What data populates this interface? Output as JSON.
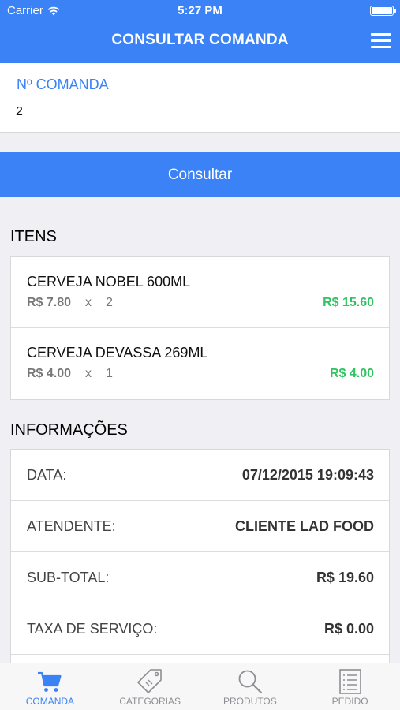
{
  "status_bar": {
    "carrier": "Carrier",
    "time": "5:27 PM"
  },
  "header": {
    "title": "CONSULTAR COMANDA",
    "menu_icon": "hamburger-menu-icon"
  },
  "form": {
    "label": "Nº COMANDA",
    "value": "2",
    "button_label": "Consultar"
  },
  "items_section": {
    "title": "ITENS",
    "items": [
      {
        "name": "CERVEJA NOBEL 600ML",
        "unit_price": "R$ 7.80",
        "times": "x",
        "quantity": "2",
        "total": "R$ 15.60"
      },
      {
        "name": "CERVEJA DEVASSA 269ML",
        "unit_price": "R$ 4.00",
        "times": "x",
        "quantity": "1",
        "total": "R$ 4.00"
      }
    ]
  },
  "info_section": {
    "title": "INFORMAÇÕES",
    "rows": [
      {
        "label": "DATA:",
        "value": "07/12/2015 19:09:43"
      },
      {
        "label": "ATENDENTE:",
        "value": "CLIENTE LAD FOOD"
      },
      {
        "label": "SUB-TOTAL:",
        "value": "R$ 19.60"
      },
      {
        "label": "TAXA DE SERVIÇO:",
        "value": "R$ 0.00"
      }
    ]
  },
  "tab_bar": {
    "active": "COMANDA",
    "tabs": [
      {
        "label": "COMANDA",
        "icon": "cart-icon"
      },
      {
        "label": "CATEGORIAS",
        "icon": "tag-icon"
      },
      {
        "label": "PRODUTOS",
        "icon": "search-icon"
      },
      {
        "label": "PEDIDO",
        "icon": "list-icon"
      }
    ]
  },
  "colors": {
    "primary": "#3a82f6",
    "positive": "#32c263",
    "background": "#efeff4"
  }
}
